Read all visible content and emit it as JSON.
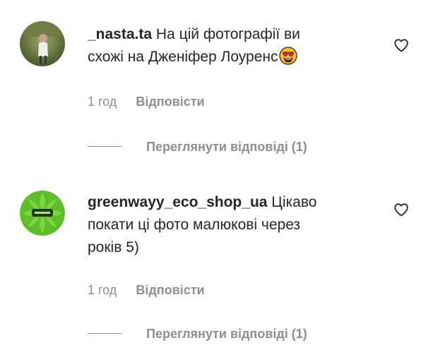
{
  "comments": [
    {
      "username": "_nasta.ta",
      "text_line1": "На цій фотографії ви",
      "text_line2": "схожі на Дженіфер Лоуренс",
      "emoji_icon": "heart-eyes-emoji",
      "avatar_icon": "user-photo-avatar",
      "time": "1 год",
      "reply_label": "Відповісти",
      "view_replies_label": "Переглянути відповіді (1)"
    },
    {
      "username": "greenwayy_eco_shop_ua",
      "text_line1": "Цікаво",
      "text_line2": "покати ці фото малюкові через",
      "text_line3": "років 5)",
      "avatar_icon": "green-logo-avatar",
      "time": "1 год",
      "reply_label": "Відповісти",
      "view_replies_label": "Переглянути відповіді (1)"
    }
  ],
  "colors": {
    "text": "#262626",
    "secondary": "#8e8e8e",
    "background": "#ffffff"
  }
}
